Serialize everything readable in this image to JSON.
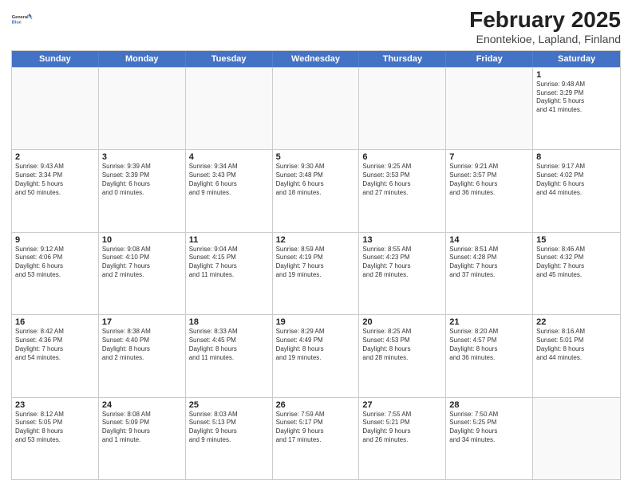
{
  "header": {
    "logo_line1": "General",
    "logo_line2": "Blue",
    "title": "February 2025",
    "subtitle": "Enontekioe, Lapland, Finland"
  },
  "weekdays": [
    "Sunday",
    "Monday",
    "Tuesday",
    "Wednesday",
    "Thursday",
    "Friday",
    "Saturday"
  ],
  "rows": [
    [
      {
        "day": "",
        "info": ""
      },
      {
        "day": "",
        "info": ""
      },
      {
        "day": "",
        "info": ""
      },
      {
        "day": "",
        "info": ""
      },
      {
        "day": "",
        "info": ""
      },
      {
        "day": "",
        "info": ""
      },
      {
        "day": "1",
        "info": "Sunrise: 9:48 AM\nSunset: 3:29 PM\nDaylight: 5 hours\nand 41 minutes."
      }
    ],
    [
      {
        "day": "2",
        "info": "Sunrise: 9:43 AM\nSunset: 3:34 PM\nDaylight: 5 hours\nand 50 minutes."
      },
      {
        "day": "3",
        "info": "Sunrise: 9:39 AM\nSunset: 3:39 PM\nDaylight: 6 hours\nand 0 minutes."
      },
      {
        "day": "4",
        "info": "Sunrise: 9:34 AM\nSunset: 3:43 PM\nDaylight: 6 hours\nand 9 minutes."
      },
      {
        "day": "5",
        "info": "Sunrise: 9:30 AM\nSunset: 3:48 PM\nDaylight: 6 hours\nand 18 minutes."
      },
      {
        "day": "6",
        "info": "Sunrise: 9:25 AM\nSunset: 3:53 PM\nDaylight: 6 hours\nand 27 minutes."
      },
      {
        "day": "7",
        "info": "Sunrise: 9:21 AM\nSunset: 3:57 PM\nDaylight: 6 hours\nand 36 minutes."
      },
      {
        "day": "8",
        "info": "Sunrise: 9:17 AM\nSunset: 4:02 PM\nDaylight: 6 hours\nand 44 minutes."
      }
    ],
    [
      {
        "day": "9",
        "info": "Sunrise: 9:12 AM\nSunset: 4:06 PM\nDaylight: 6 hours\nand 53 minutes."
      },
      {
        "day": "10",
        "info": "Sunrise: 9:08 AM\nSunset: 4:10 PM\nDaylight: 7 hours\nand 2 minutes."
      },
      {
        "day": "11",
        "info": "Sunrise: 9:04 AM\nSunset: 4:15 PM\nDaylight: 7 hours\nand 11 minutes."
      },
      {
        "day": "12",
        "info": "Sunrise: 8:59 AM\nSunset: 4:19 PM\nDaylight: 7 hours\nand 19 minutes."
      },
      {
        "day": "13",
        "info": "Sunrise: 8:55 AM\nSunset: 4:23 PM\nDaylight: 7 hours\nand 28 minutes."
      },
      {
        "day": "14",
        "info": "Sunrise: 8:51 AM\nSunset: 4:28 PM\nDaylight: 7 hours\nand 37 minutes."
      },
      {
        "day": "15",
        "info": "Sunrise: 8:46 AM\nSunset: 4:32 PM\nDaylight: 7 hours\nand 45 minutes."
      }
    ],
    [
      {
        "day": "16",
        "info": "Sunrise: 8:42 AM\nSunset: 4:36 PM\nDaylight: 7 hours\nand 54 minutes."
      },
      {
        "day": "17",
        "info": "Sunrise: 8:38 AM\nSunset: 4:40 PM\nDaylight: 8 hours\nand 2 minutes."
      },
      {
        "day": "18",
        "info": "Sunrise: 8:33 AM\nSunset: 4:45 PM\nDaylight: 8 hours\nand 11 minutes."
      },
      {
        "day": "19",
        "info": "Sunrise: 8:29 AM\nSunset: 4:49 PM\nDaylight: 8 hours\nand 19 minutes."
      },
      {
        "day": "20",
        "info": "Sunrise: 8:25 AM\nSunset: 4:53 PM\nDaylight: 8 hours\nand 28 minutes."
      },
      {
        "day": "21",
        "info": "Sunrise: 8:20 AM\nSunset: 4:57 PM\nDaylight: 8 hours\nand 36 minutes."
      },
      {
        "day": "22",
        "info": "Sunrise: 8:16 AM\nSunset: 5:01 PM\nDaylight: 8 hours\nand 44 minutes."
      }
    ],
    [
      {
        "day": "23",
        "info": "Sunrise: 8:12 AM\nSunset: 5:05 PM\nDaylight: 8 hours\nand 53 minutes."
      },
      {
        "day": "24",
        "info": "Sunrise: 8:08 AM\nSunset: 5:09 PM\nDaylight: 9 hours\nand 1 minute."
      },
      {
        "day": "25",
        "info": "Sunrise: 8:03 AM\nSunset: 5:13 PM\nDaylight: 9 hours\nand 9 minutes."
      },
      {
        "day": "26",
        "info": "Sunrise: 7:59 AM\nSunset: 5:17 PM\nDaylight: 9 hours\nand 17 minutes."
      },
      {
        "day": "27",
        "info": "Sunrise: 7:55 AM\nSunset: 5:21 PM\nDaylight: 9 hours\nand 26 minutes."
      },
      {
        "day": "28",
        "info": "Sunrise: 7:50 AM\nSunset: 5:25 PM\nDaylight: 9 hours\nand 34 minutes."
      },
      {
        "day": "",
        "info": ""
      }
    ]
  ]
}
